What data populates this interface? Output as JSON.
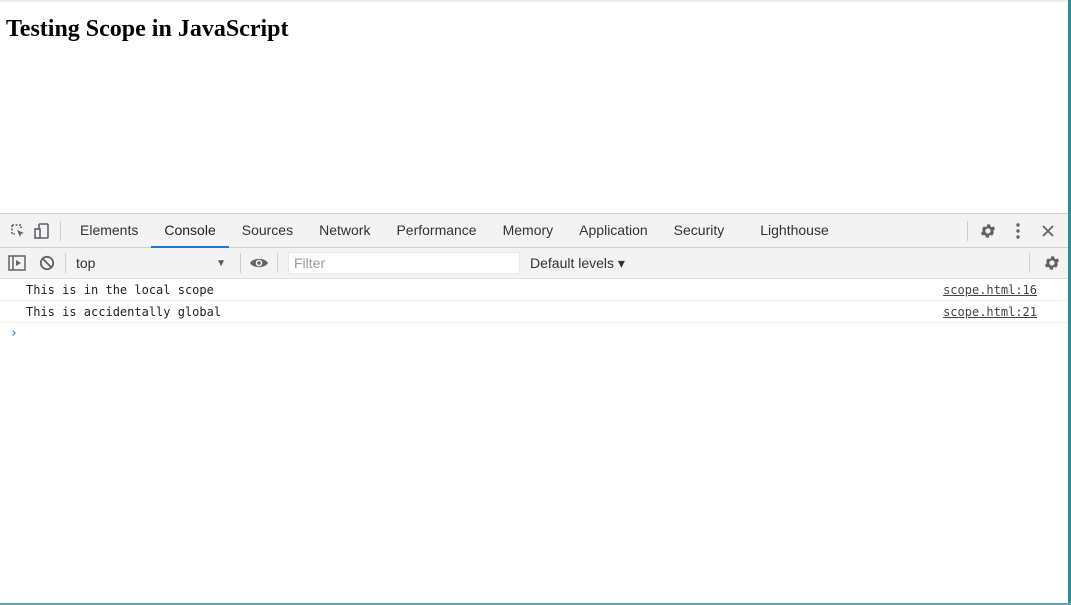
{
  "page": {
    "heading": "Testing Scope in JavaScript"
  },
  "devtools": {
    "tabs": [
      {
        "label": "Elements",
        "active": false
      },
      {
        "label": "Console",
        "active": true
      },
      {
        "label": "Sources",
        "active": false
      },
      {
        "label": "Network",
        "active": false
      },
      {
        "label": "Performance",
        "active": false
      },
      {
        "label": "Memory",
        "active": false
      },
      {
        "label": "Application",
        "active": false
      },
      {
        "label": "Security",
        "active": false
      },
      {
        "label": "Lighthouse",
        "active": false
      }
    ],
    "toolbar": {
      "context": "top",
      "filter_placeholder": "Filter",
      "levels": "Default levels ▾"
    },
    "console": [
      {
        "message": "This is in the local scope",
        "source": "scope.html:16"
      },
      {
        "message": "This is accidentally global",
        "source": "scope.html:21"
      }
    ],
    "prompt": "›"
  },
  "colors": {
    "accent": "#1a73e8",
    "window_edge": "#2a8f93"
  }
}
